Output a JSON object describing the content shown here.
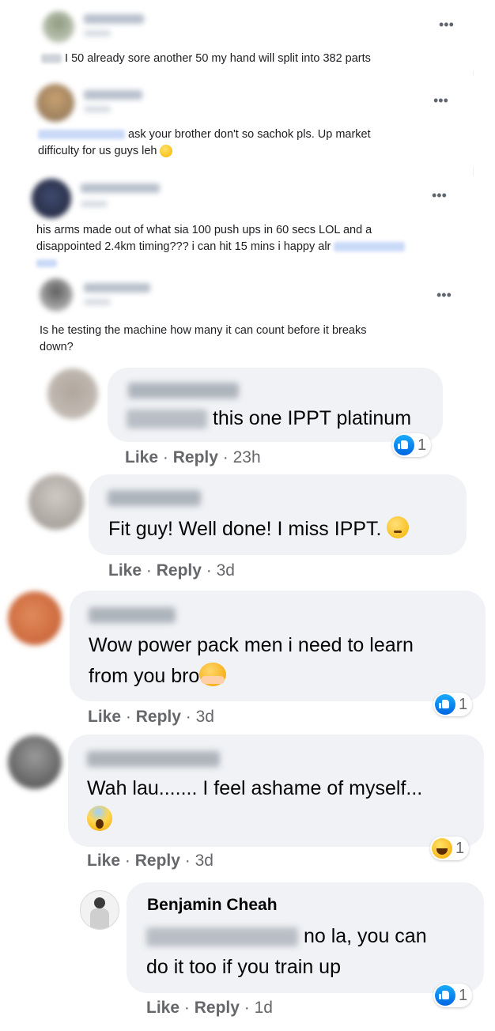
{
  "small_comments": [
    {
      "text": "I 50 already sore another 50 my hand will split into 382 parts",
      "more": "•••"
    },
    {
      "text_line1": "ask your brother don't so sachok pls. Up market",
      "text_line2": "difficulty for us guys leh",
      "more": "•••"
    },
    {
      "text_line1": "his arms made out of what sia 100 push ups in 60 secs LOL and a",
      "text_line2": "disappointed 2.4km timing??? i can hit 15 mins i happy alr",
      "more": "•••"
    },
    {
      "text_line1": "Is he testing the machine how many it can count before it breaks",
      "text_line2": "down?",
      "more": "•••"
    }
  ],
  "comments": [
    {
      "text": "this one IPPT platinum",
      "like": "Like",
      "reply": "Reply",
      "time": "23h",
      "reaction_count": "1",
      "reaction_icon": "like-icon"
    },
    {
      "text": "Fit guy! Well done! I miss IPPT.",
      "like": "Like",
      "reply": "Reply",
      "time": "3d",
      "emoji": "pensive-face-emoji"
    },
    {
      "text_line1": "Wow power pack men i need to learn",
      "text_line2": "from you bro",
      "like": "Like",
      "reply": "Reply",
      "time": "3d",
      "reaction_count": "1",
      "reaction_icon": "like-icon",
      "emoji": "hugging-face-emoji"
    },
    {
      "text": "Wah lau....... I feel ashame of myself...",
      "like": "Like",
      "reply": "Reply",
      "time": "3d",
      "reaction_count": "1",
      "reaction_icon": "haha-icon",
      "emoji": "screaming-face-emoji"
    }
  ],
  "reply": {
    "author": "Benjamin Cheah",
    "text_line1": "no la, you can",
    "text_line2": "do it too if you train up",
    "like": "Like",
    "reply": "Reply",
    "time": "1d",
    "reaction_count": "1",
    "reaction_icon": "like-icon"
  },
  "separator": "·",
  "colors": {
    "bubble": "#f0f2f5",
    "like_blue": "#1877f2",
    "secondary_text": "#65676b"
  }
}
